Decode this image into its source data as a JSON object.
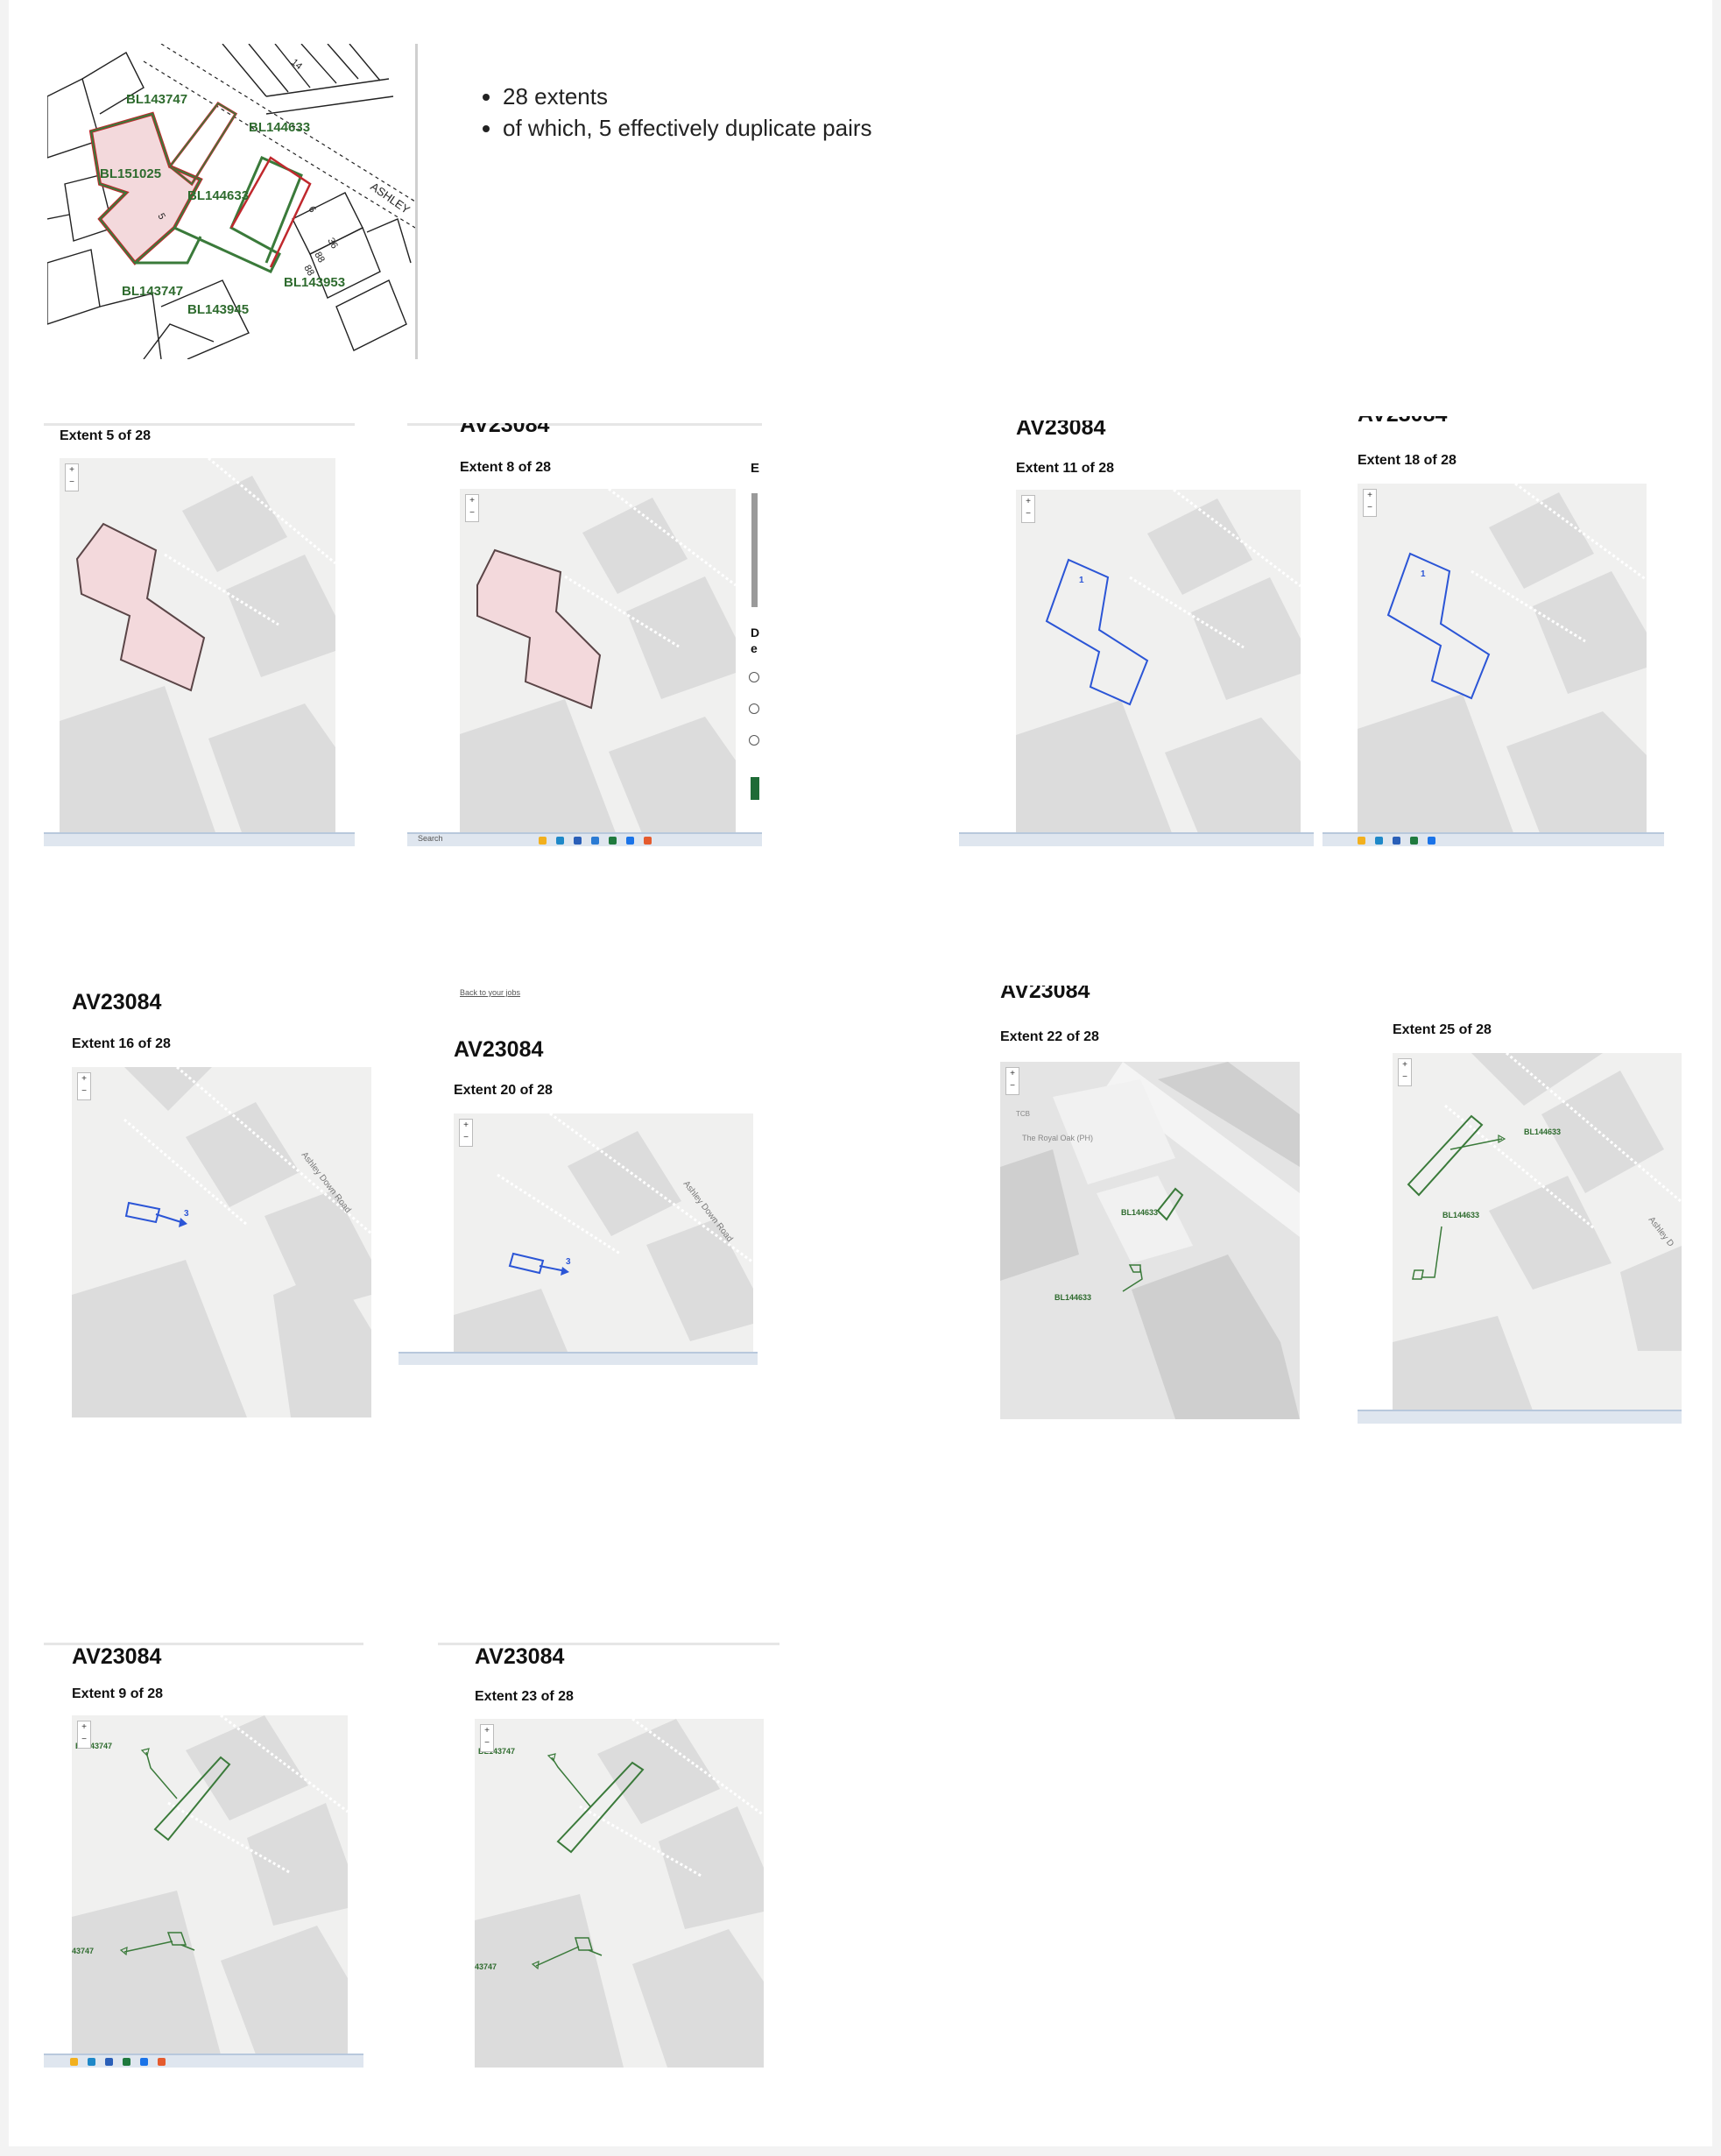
{
  "overview": {
    "labels": [
      "BL143747",
      "BL144633",
      "BL151025",
      "BL144633",
      "BL143747",
      "BL143945",
      "BL143953"
    ],
    "road": "ASHLEY",
    "numbers": [
      "14",
      "6",
      "5",
      "36",
      "88",
      "88"
    ]
  },
  "bullets": [
    "28 extents",
    "of which, 5 effectively duplicate pairs"
  ],
  "screenshots": [
    {
      "heading": "",
      "extent": "Extent 5 of 28"
    },
    {
      "heading": "AV23084",
      "extent": "Extent 8 of 28",
      "side_letter": "E",
      "side_letters2": "D\ne"
    },
    {
      "heading": "AV23084",
      "extent": "Extent 11 of 28",
      "polygon_label": "1"
    },
    {
      "heading": "AV23084",
      "extent": "Extent 18 of 28",
      "polygon_label": "1"
    },
    {
      "heading": "AV23084",
      "extent": "Extent 16 of 28",
      "polygon_label": "3",
      "road_label": "Ashley Down Road"
    },
    {
      "heading": "AV23084",
      "extent": "Extent 20 of 28",
      "polygon_label": "3",
      "road_label": "Ashley Down Road",
      "top_link": "Back to your jobs"
    },
    {
      "heading": "AV23084",
      "extent": "Extent 22 of 28",
      "labels": [
        "BL144633",
        "BL144633"
      ],
      "poi": "The Royal Oak (PH)",
      "poi_short": "TCB"
    },
    {
      "heading": "AV23084",
      "extent": "Extent 25 of 28",
      "labels": [
        "BL144633",
        "BL144633"
      ],
      "road_label": "Ashley D"
    },
    {
      "heading": "AV23084",
      "extent": "Extent 9 of 28",
      "labels": [
        "BL143747",
        "43747"
      ]
    },
    {
      "heading": "AV23084",
      "extent": "Extent 23 of 28",
      "labels": [
        "BL143747",
        "43747"
      ]
    }
  ],
  "taskbar": {
    "search_placeholder": "Search"
  },
  "colors": {
    "pink_fill": "#f3d9dc",
    "red_outline": "#c0282d",
    "green_outline": "#3a7a3a",
    "blue_outline": "#2b55d6",
    "map_bg": "#f0f0ef",
    "building": "#dcdcdc"
  }
}
